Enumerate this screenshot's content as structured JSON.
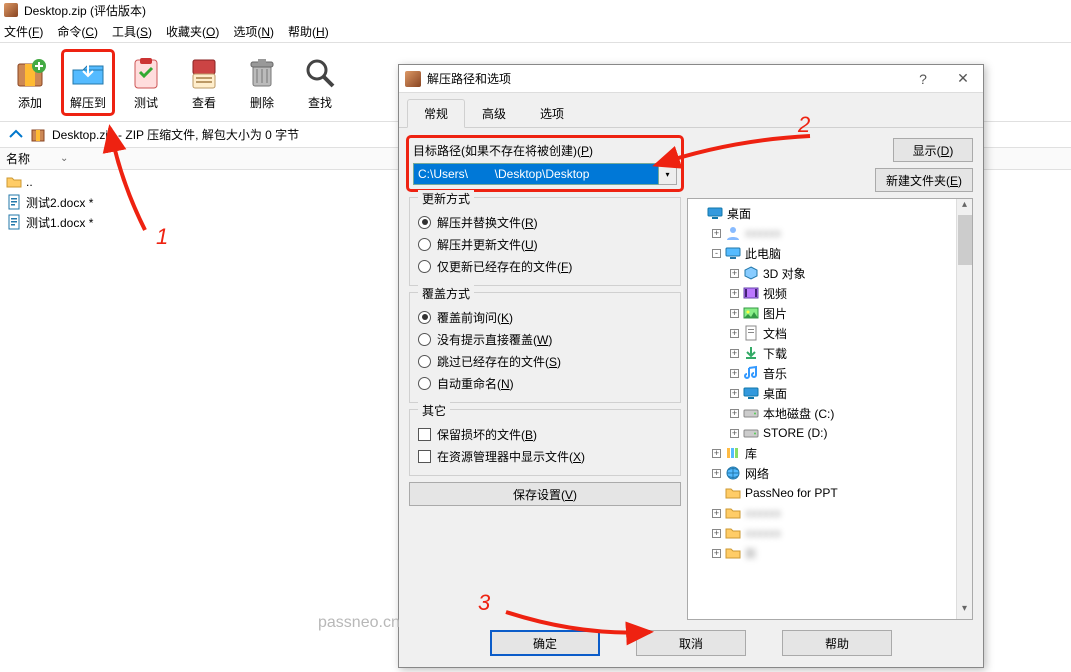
{
  "title": "Desktop.zip (评估版本)",
  "menu": [
    "文件(F)",
    "命令(C)",
    "工具(S)",
    "收藏夹(O)",
    "选项(N)",
    "帮助(H)"
  ],
  "toolbar": [
    {
      "label": "添加",
      "name": "add-button"
    },
    {
      "label": "解压到",
      "name": "extract-to-button",
      "highlighted": true
    },
    {
      "label": "测试",
      "name": "test-button"
    },
    {
      "label": "查看",
      "name": "view-button"
    },
    {
      "label": "删除",
      "name": "delete-button"
    },
    {
      "label": "查找",
      "name": "find-button"
    }
  ],
  "pathbar": "Desktop.zip - ZIP 压缩文件, 解包大小为 0 字节",
  "list_header": {
    "name": "名称"
  },
  "files": [
    {
      "name": "..",
      "type": "folder"
    },
    {
      "name": "测试2.docx *",
      "type": "docx"
    },
    {
      "name": "测试1.docx *",
      "type": "docx"
    }
  ],
  "dialog": {
    "title": "解压路径和选项",
    "tabs": [
      "常规",
      "高级",
      "选项"
    ],
    "active_tab": 0,
    "target_label": "目标路径(如果不存在将被创建)(P)",
    "target_path": "C:\\Users\\        \\Desktop\\Desktop",
    "display_btn": "显示(D)",
    "newfolder_btn": "新建文件夹(E)",
    "groups": {
      "update": {
        "legend": "更新方式",
        "options": [
          "解压并替换文件(R)",
          "解压并更新文件(U)",
          "仅更新已经存在的文件(F)"
        ],
        "checked": 0,
        "type": "radio"
      },
      "overwrite": {
        "legend": "覆盖方式",
        "options": [
          "覆盖前询问(K)",
          "没有提示直接覆盖(W)",
          "跳过已经存在的文件(S)",
          "自动重命名(N)"
        ],
        "checked": 0,
        "type": "radio"
      },
      "other": {
        "legend": "其它",
        "options": [
          "保留损坏的文件(B)",
          "在资源管理器中显示文件(X)"
        ],
        "type": "check"
      }
    },
    "save_btn": "保存设置(V)",
    "tree": [
      {
        "depth": 0,
        "icon": "desktop",
        "label": "桌面",
        "exp": ""
      },
      {
        "depth": 1,
        "icon": "user",
        "label": "",
        "exp": "+",
        "blur": true
      },
      {
        "depth": 1,
        "icon": "pc",
        "label": "此电脑",
        "exp": "-"
      },
      {
        "depth": 2,
        "icon": "3d",
        "label": "3D 对象",
        "exp": "+"
      },
      {
        "depth": 2,
        "icon": "video",
        "label": "视频",
        "exp": "+"
      },
      {
        "depth": 2,
        "icon": "pic",
        "label": "图片",
        "exp": "+"
      },
      {
        "depth": 2,
        "icon": "doc",
        "label": "文档",
        "exp": "+"
      },
      {
        "depth": 2,
        "icon": "dl",
        "label": "下载",
        "exp": "+"
      },
      {
        "depth": 2,
        "icon": "music",
        "label": "音乐",
        "exp": "+"
      },
      {
        "depth": 2,
        "icon": "desktop",
        "label": "桌面",
        "exp": "+"
      },
      {
        "depth": 2,
        "icon": "disk",
        "label": "本地磁盘 (C:)",
        "exp": "+"
      },
      {
        "depth": 2,
        "icon": "disk",
        "label": "STORE (D:)",
        "exp": "+"
      },
      {
        "depth": 1,
        "icon": "lib",
        "label": "库",
        "exp": "+"
      },
      {
        "depth": 1,
        "icon": "net",
        "label": "网络",
        "exp": "+"
      },
      {
        "depth": 1,
        "icon": "folder",
        "label": "PassNeo for PPT",
        "exp": ""
      },
      {
        "depth": 1,
        "icon": "folder",
        "label": "",
        "exp": "+",
        "blur": true
      },
      {
        "depth": 1,
        "icon": "folder",
        "label": "",
        "exp": "+",
        "blur": true
      },
      {
        "depth": 1,
        "icon": "folder",
        "label": "新",
        "exp": "+",
        "blur": true
      }
    ],
    "footer": [
      "确定",
      "取消",
      "帮助"
    ]
  },
  "annotations": {
    "n1": "1",
    "n2": "2",
    "n3": "3"
  },
  "watermark": "passneo.cn"
}
